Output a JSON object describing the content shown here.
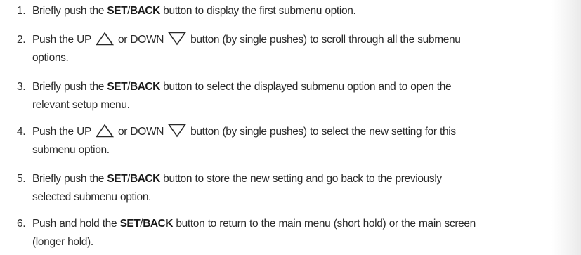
{
  "steps": [
    {
      "number": "1.",
      "parts": {
        "a": "Briefly push the ",
        "kw1": "SET",
        "sep": "/",
        "kw2": "BACK",
        "b": " button to display the first submenu option."
      }
    },
    {
      "number": "2.",
      "parts": {
        "a": "Push the UP",
        "mid": "or DOWN",
        "b": "button (by single pushes) to scroll through all the submenu",
        "c": "options."
      }
    },
    {
      "number": "3.",
      "parts": {
        "a": "Briefly push the ",
        "kw1": "SET",
        "sep": "/",
        "kw2": "BACK",
        "b": " button to select the displayed submenu option and to open the",
        "c": "relevant setup menu."
      }
    },
    {
      "number": "4.",
      "parts": {
        "a": "Push the UP",
        "mid": "or DOWN",
        "b": "button (by single pushes) to select the new setting for this",
        "c": "submenu option."
      }
    },
    {
      "number": "5.",
      "parts": {
        "a": "Briefly push the ",
        "kw1": "SET",
        "sep": "/",
        "kw2": "BACK",
        "b": " button to store the new setting and go back to the previously",
        "c": "selected submenu option."
      }
    },
    {
      "number": "6.",
      "parts": {
        "a": "Push and hold the ",
        "kw1": "SET",
        "sep": "/",
        "kw2": "BACK",
        "b": " button to return to the main menu (short hold) or the main screen",
        "c": "(longer hold)."
      }
    }
  ],
  "icons": {
    "up": "triangle-up-outline",
    "down": "triangle-down-outline"
  }
}
